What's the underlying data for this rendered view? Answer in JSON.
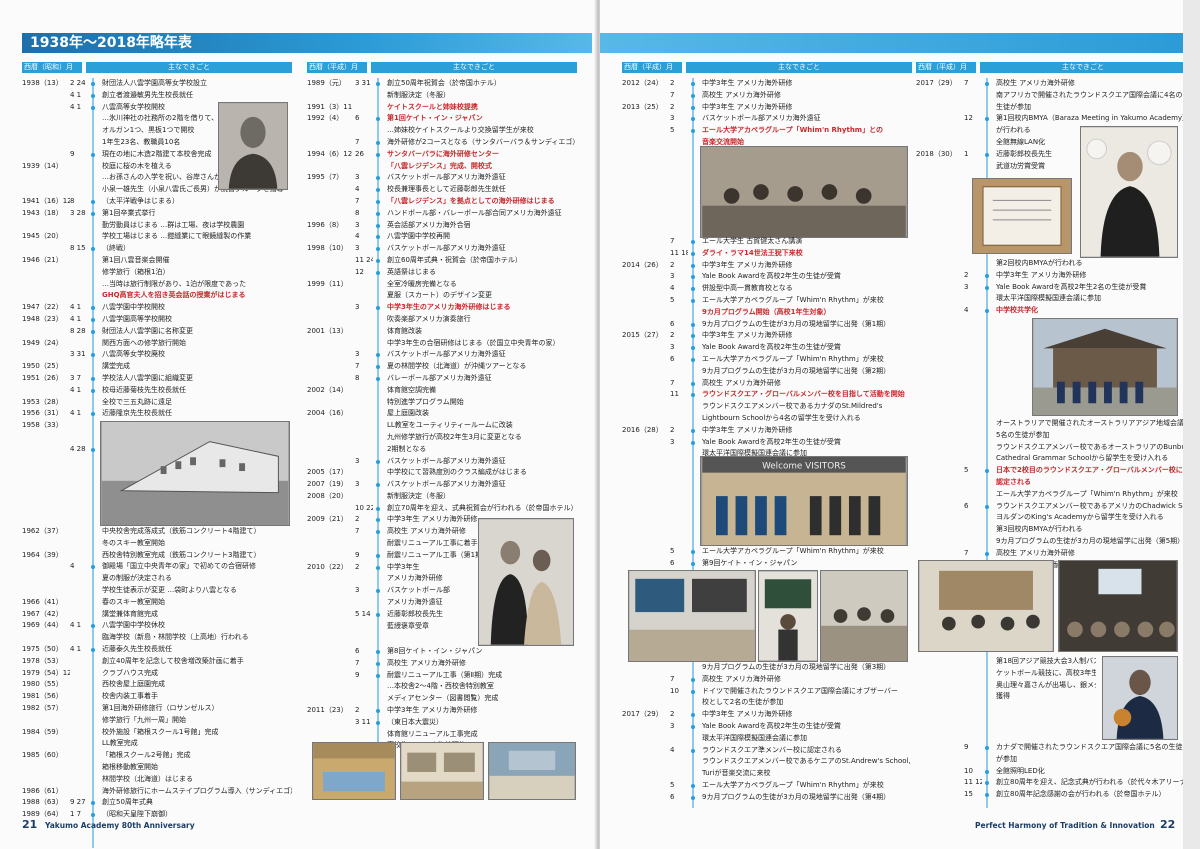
{
  "title": "1938年～2018年略年表",
  "headers": {
    "date": "西暦（昭和）月 日",
    "date2": "西暦（平成）月 日",
    "event": "主なできごと"
  },
  "columns": [
    {
      "id": "c1",
      "rows": [
        {
          "y": "1938（13）",
          "md": "2 24",
          "e": "財団法人八雲学園高等女学校設立"
        },
        {
          "y": "",
          "md": "4 1",
          "e": "創立者渡邉敏男先生校長就任"
        },
        {
          "y": "",
          "md": "4 1",
          "e": "八雲高等女学校開校"
        },
        {
          "y": "",
          "md": "",
          "e": "…氷川神社の社務所の2階を借りて、"
        },
        {
          "y": "",
          "md": "",
          "e": "オルガン1つ、黒板1つで開校"
        },
        {
          "y": "",
          "md": "",
          "e": "1年生23名、教職員10名"
        },
        {
          "y": "",
          "md": "9",
          "e": "現在の地に木造2階建て本校舎完成"
        },
        {
          "y": "1939（14）",
          "md": "",
          "e": "校庭に桜の木を植える"
        },
        {
          "y": "",
          "md": "",
          "e": "…お孫さんの入学を祝い、谷岸さんが若木をご寄贈"
        },
        {
          "y": "",
          "md": "",
          "e": "小泉一雄先生（小泉八雲氏ご長男）が読書グループを指導"
        },
        {
          "y": "1941（16）12",
          "md": "8",
          "e": "（太平洋戦争はじまる）"
        },
        {
          "y": "1943（18）",
          "md": "3 28",
          "e": "第1回卒業式挙行"
        },
        {
          "y": "",
          "md": "",
          "e": "勤労動員はじまる …群は工場、夜は学校農園"
        },
        {
          "y": "1945（20）",
          "md": "",
          "e": "学校工場はじまる …鎧縫業にて眼鏡縫製の作業"
        },
        {
          "y": "",
          "md": "8 15",
          "e": "（終戦）"
        },
        {
          "y": "1946（21）",
          "md": "",
          "e": "第1回八雲音楽会開催"
        },
        {
          "y": "",
          "md": "",
          "e": "修学旅行（箱根1泊）"
        },
        {
          "y": "",
          "md": "",
          "e": "…当時は旅行制限があり、1泊が限度であった"
        },
        {
          "y": "",
          "md": "",
          "e": "GHQ高官夫人を招き英会話の授業がはじまる",
          "hl": true
        },
        {
          "y": "1947（22）",
          "md": "4 1",
          "e": "八雲学園中学校開校"
        },
        {
          "y": "1948（23）",
          "md": "4 1",
          "e": "八雲学園高等学校開校"
        },
        {
          "y": "",
          "md": "8 28",
          "e": "財団法人八雲学園に名称変更"
        },
        {
          "y": "1949（24）",
          "md": "",
          "e": "関西方面への修学旅行開始"
        },
        {
          "y": "",
          "md": "3 31",
          "e": "八雲高等女学校廃校"
        },
        {
          "y": "1950（25）",
          "md": "",
          "e": "講堂完成"
        },
        {
          "y": "1951（26）",
          "md": "3 7",
          "e": "学校法人八雲学園に組織変更"
        },
        {
          "y": "",
          "md": "4 1",
          "e": "校母近藤菊枝先生校長就任"
        },
        {
          "y": "1953（28）",
          "md": "",
          "e": "全校で三五丸跡に遠足"
        },
        {
          "y": "1956（31）",
          "md": "4 1",
          "e": "近藤隆京先生校長就任"
        },
        {
          "y": "1958（33）",
          "md": "",
          "e": "創立20周年"
        },
        {
          "y": "",
          "md": "",
          "e": "…記念事業として施設近代化計画に着手"
        },
        {
          "y": "",
          "md": "4 28",
          "e": "東校舎完成落成式（鉄筋コンクリート3階建て）"
        }
      ]
    },
    {
      "id": "c1b",
      "rows": [
        {
          "y": "1962（37）",
          "md": "",
          "e": "中央校舎完成落成式（鉄筋コンクリート4階建て）"
        },
        {
          "y": "",
          "md": "",
          "e": "冬のスキー教室開始"
        },
        {
          "y": "1964（39）",
          "md": "",
          "e": "西校舎特別教室完成（鉄筋コンクリート3階建て）"
        },
        {
          "y": "",
          "md": "4",
          "e": "御殿場「国立中央青年の家」で初めての合宿研修"
        },
        {
          "y": "",
          "md": "",
          "e": "夏の制服が決定される"
        },
        {
          "y": "",
          "md": "",
          "e": "学校生徒表示が変更 …袋町より八雲となる"
        },
        {
          "y": "1966（41）",
          "md": "",
          "e": "春のスキー教室開始"
        },
        {
          "y": "1967（42）",
          "md": "",
          "e": "講堂兼体育館完成"
        },
        {
          "y": "1969（44）",
          "md": "4 1",
          "e": "八雲学園中学校休校"
        },
        {
          "y": "",
          "md": "",
          "e": "臨海学校（新島・林間学校（上高地）行われる"
        },
        {
          "y": "1975（50）",
          "md": "4 1",
          "e": "近藤泰久先生校長就任"
        },
        {
          "y": "1978（53）",
          "md": "",
          "e": "創立40周年を記念して校舎増改築計画に着手"
        },
        {
          "y": "1979（54）12",
          "md": "",
          "e": "クラブハウス完成"
        },
        {
          "y": "1980（55）",
          "md": "",
          "e": "西校舎屋上庭園完成"
        },
        {
          "y": "1981（56）",
          "md": "",
          "e": "校舎内装工事着手"
        },
        {
          "y": "1982（57）",
          "md": "",
          "e": "第1回海外研修旅行（ロサンゼルス）"
        },
        {
          "y": "",
          "md": "",
          "e": "修学旅行「九州一周」開始"
        },
        {
          "y": "1984（59）",
          "md": "",
          "e": "校外施設「箱根スクール1号館」完成"
        },
        {
          "y": "",
          "md": "",
          "e": "LL教室完成"
        },
        {
          "y": "1985（60）",
          "md": "",
          "e": "「箱根スクール2号館」完成"
        },
        {
          "y": "",
          "md": "",
          "e": "箱根移動教室開始"
        },
        {
          "y": "",
          "md": "",
          "e": "林間学校（北海道）はじまる"
        },
        {
          "y": "1986（61）",
          "md": "",
          "e": "海外研修旅行にホームステイプログラム導入（サンディエゴ）"
        },
        {
          "y": "1988（63）",
          "md": "9 27",
          "e": "創立50周年式典"
        },
        {
          "y": "1989（64）",
          "md": "1 7",
          "e": "（昭和天皇陛下崩御）"
        }
      ]
    },
    {
      "id": "c2",
      "rows": [
        {
          "y": "1989（元）",
          "md": "3 31",
          "e": "創立50周年祝賀会（於帝国ホテル）"
        },
        {
          "y": "",
          "md": "",
          "e": "新制服決定（冬服）"
        },
        {
          "y": "1991（3）11",
          "md": "",
          "e": "ケイトスクールと姉妹校提携",
          "hl": true
        },
        {
          "y": "1992（4）",
          "md": "6",
          "e": "第1回ケイト・イン・ジャパン",
          "hl": true
        },
        {
          "y": "",
          "md": "",
          "e": "…姉妹校ケイトスクールより交換留学生が来校"
        },
        {
          "y": "",
          "md": "7",
          "e": "海外研修が2コースとなる（サンタバーバラ＆サンディエゴ）"
        },
        {
          "y": "1994（6）12",
          "md": "26",
          "e": "サンタバーバラに海外研修センター",
          "hl": true
        },
        {
          "y": "",
          "md": "",
          "e": "「八雲レジデンス」完成、開校式",
          "hl": true
        },
        {
          "y": "1995（7）",
          "md": "3",
          "e": "バスケットボール部アメリカ海外遠征"
        },
        {
          "y": "",
          "md": "4",
          "e": "校長兼理事長として近藤彰郎先生就任"
        },
        {
          "y": "",
          "md": "7",
          "e": "「八雲レジデンス」を拠点としての海外研修はじまる",
          "hl": true
        },
        {
          "y": "",
          "md": "8",
          "e": "ハンドボール部・バレーボール部合同アメリカ海外遠征"
        },
        {
          "y": "1996（8）",
          "md": "3",
          "e": "英会話部アメリカ海外合宿"
        },
        {
          "y": "",
          "md": "4",
          "e": "八雲学園中学校再開"
        },
        {
          "y": "1998（10）",
          "md": "3",
          "e": "バスケットボール部アメリカ海外遠征"
        },
        {
          "y": "",
          "md": "11 24",
          "e": "創立60周年式典・祝賀会（於帝国ホテル）"
        },
        {
          "y": "",
          "md": "12",
          "e": "英語祭はじまる"
        },
        {
          "y": "1999（11）",
          "md": "",
          "e": "全室冷暖房完備となる"
        },
        {
          "y": "",
          "md": "",
          "e": "夏服（スカート）のデザイン変更"
        },
        {
          "y": "",
          "md": "3",
          "e": "中学3年生のアメリカ海外研修はじまる",
          "hl": true
        },
        {
          "y": "",
          "md": "",
          "e": "吹奏楽部アメリカ演奏旅行"
        },
        {
          "y": "2001（13）",
          "md": "",
          "e": "体育館改装"
        },
        {
          "y": "",
          "md": "",
          "e": "中学3年生の合宿研修はじまる（於国立中央青年の家）"
        },
        {
          "y": "",
          "md": "3",
          "e": "バスケットボール部アメリカ海外遠征"
        },
        {
          "y": "",
          "md": "7",
          "e": "夏の林間学校（北海道）が沖縄ツアーとなる"
        },
        {
          "y": "",
          "md": "8",
          "e": "バレーボール部アメリカ海外遠征"
        },
        {
          "y": "2002（14）",
          "md": "",
          "e": "体育館空調完備"
        },
        {
          "y": "",
          "md": "",
          "e": "特別進学プログラム開始"
        },
        {
          "y": "2004（16）",
          "md": "",
          "e": "屋上庭園改装"
        },
        {
          "y": "",
          "md": "",
          "e": "LL教室をユーティリティールームに改装"
        },
        {
          "y": "",
          "md": "",
          "e": "九州修学旅行が高校2年生3月に変更となる"
        },
        {
          "y": "",
          "md": "",
          "e": "2期制となる"
        },
        {
          "y": "",
          "md": "3",
          "e": "バスケットボール部アメリカ海外遠征"
        },
        {
          "y": "2005（17）",
          "md": "",
          "e": "中学校にて習熟度別のクラス編成がはじまる"
        },
        {
          "y": "2007（19）",
          "md": "3",
          "e": "バスケットボール部アメリカ海外遠征"
        },
        {
          "y": "2008（20）",
          "md": "",
          "e": "新制服決定（冬服）"
        },
        {
          "y": "",
          "md": "10 22",
          "e": "創立70周年を迎え、式典祝賀会が行われる（於帝国ホテル）"
        },
        {
          "y": "2009（21）",
          "md": "2",
          "e": "中学3年生 アメリカ海外研修"
        },
        {
          "y": "",
          "md": "7",
          "e": "高校生 アメリカ海外研修"
        },
        {
          "y": "",
          "md": "",
          "e": "耐震リニューアル工事に着手"
        },
        {
          "y": "",
          "md": "9",
          "e": "耐震リニューアル工事（第1期）完成…本校舎1階・東校舎"
        },
        {
          "y": "2010（22）",
          "md": "2",
          "e": "中学3年生"
        },
        {
          "y": "",
          "md": "",
          "e": "アメリカ海外研修"
        },
        {
          "y": "",
          "md": "3",
          "e": "バスケットボール部"
        },
        {
          "y": "",
          "md": "",
          "e": "アメリカ海外遠征"
        },
        {
          "y": "",
          "md": "5 14",
          "e": "近藤彰郎校長先生"
        },
        {
          "y": "",
          "md": "",
          "e": "藍綬褒章受章"
        }
      ]
    },
    {
      "id": "c2b",
      "rows": [
        {
          "y": "",
          "md": "6",
          "e": "第8回ケイト・イン・ジャパン"
        },
        {
          "y": "",
          "md": "7",
          "e": "高校生 アメリカ海外研修"
        },
        {
          "y": "",
          "md": "9",
          "e": "耐震リニューアル工事（第Ⅱ期）完成"
        },
        {
          "y": "",
          "md": "",
          "e": "…本校舎2～4階・西校舎特別教室"
        },
        {
          "y": "",
          "md": "",
          "e": "メディアセンター（図書閲覧）完成"
        },
        {
          "y": "2011（23）",
          "md": "2",
          "e": "中学3年生 アメリカ海外研修"
        },
        {
          "y": "",
          "md": "3 11",
          "e": "（東日本大震災）"
        },
        {
          "y": "",
          "md": "",
          "e": "体育館リニューアル工事完成"
        },
        {
          "y": "",
          "md": "7",
          "e": "高校生 アメリカ海外研修"
        }
      ]
    },
    {
      "id": "c3",
      "rows": [
        {
          "y": "2012（24）",
          "md": "2",
          "e": "中学3年生 アメリカ海外研修"
        },
        {
          "y": "",
          "md": "7",
          "e": "高校生 アメリカ海外研修"
        },
        {
          "y": "2013（25）",
          "md": "2",
          "e": "中学3年生 アメリカ海外研修"
        },
        {
          "y": "",
          "md": "3",
          "e": "バスケットボール部アメリカ海外遠征"
        },
        {
          "y": "",
          "md": "5",
          "e": "エール大学アカペラグループ「Whim'n Rhythm」との",
          "hl": true
        },
        {
          "y": "",
          "md": "",
          "e": "音楽交流開始",
          "hl": true
        }
      ]
    },
    {
      "id": "c3b",
      "rows": [
        {
          "y": "",
          "md": "7",
          "e": "エール大学生 古賀健太さん講演"
        },
        {
          "y": "",
          "md": "11 18",
          "e": "ダライ・ラマ14世法王猊下来校",
          "hl": true
        },
        {
          "y": "2014（26）",
          "md": "2",
          "e": "中学3年生 アメリカ海外研修"
        },
        {
          "y": "",
          "md": "3",
          "e": "Yale Book Awardを高校2年生の生徒が受賞"
        },
        {
          "y": "",
          "md": "4",
          "e": "併設型中高一貫教育校となる"
        },
        {
          "y": "",
          "md": "5",
          "e": "エール大学アカペラグループ「Whim'n Rhythm」が来校"
        },
        {
          "y": "",
          "md": "",
          "e": "9カ月プログラム開始（高校1年生対象）",
          "hl": true
        },
        {
          "y": "",
          "md": "6",
          "e": "9カ月プログラムの生徒が3カ月の現地留学に出発（第1期）"
        },
        {
          "y": "2015（27）",
          "md": "2",
          "e": "中学3年生 アメリカ海外研修"
        },
        {
          "y": "",
          "md": "3",
          "e": "Yale Book Awardを高校2年生の生徒が受賞"
        },
        {
          "y": "",
          "md": "6",
          "e": "エール大学アカペラグループ「Whim'n Rhythm」が来校"
        },
        {
          "y": "",
          "md": "",
          "e": "9カ月プログラムの生徒が3カ月の現地留学に出発（第2期）"
        },
        {
          "y": "",
          "md": "7",
          "e": "高校生 アメリカ海外研修"
        },
        {
          "y": "",
          "md": "11",
          "e": "ラウンドスクエア・グローバルメンバー校を目指して活動を開始",
          "hl": true
        },
        {
          "y": "",
          "md": "",
          "e": "ラウンドスクエアメンバー校であるカナダのSt.Mildred's"
        },
        {
          "y": "",
          "md": "",
          "e": "Lightbourn Schoolから4名の留学生を受け入れる"
        },
        {
          "y": "2016（28）",
          "md": "2",
          "e": "中学3年生 アメリカ海外研修"
        },
        {
          "y": "",
          "md": "3",
          "e": "Yale Book Awardを高校2年生の生徒が受賞"
        },
        {
          "y": "",
          "md": "",
          "e": "環太平洋国際模擬国連会議に参加"
        },
        {
          "y": "",
          "md": "",
          "e": "バスケットボール部アメリカ海外遠征"
        }
      ]
    },
    {
      "id": "c3c",
      "rows": [
        {
          "y": "",
          "md": "5",
          "e": "エール大学アカペラグループ「Whim'n Rhythm」が来校"
        },
        {
          "y": "",
          "md": "6",
          "e": "第9回ケイト・イン・ジャパン"
        }
      ]
    },
    {
      "id": "c3d",
      "rows": [
        {
          "y": "",
          "md": "",
          "e": "9カ月プログラムの生徒が3カ月の現地留学に出発（第3期）"
        },
        {
          "y": "",
          "md": "7",
          "e": "高校生 アメリカ海外研修"
        },
        {
          "y": "",
          "md": "10",
          "e": "ドイツで開催されたラウンドスクエア国際会議にオブザーバー"
        },
        {
          "y": "",
          "md": "",
          "e": "校として2名の生徒が参加"
        },
        {
          "y": "2017（29）",
          "md": "2",
          "e": "中学3年生 アメリカ海外研修"
        },
        {
          "y": "",
          "md": "3",
          "e": "Yale Book Awardを高校2年生の生徒が受賞"
        },
        {
          "y": "",
          "md": "",
          "e": "環太平洋国際模擬国連会議に参加"
        },
        {
          "y": "",
          "md": "4",
          "e": "ラウンドスクエア準メンバー校に認定される"
        },
        {
          "y": "",
          "md": "",
          "e": "ラウンドスクエアメンバー校であるケニアのSt.Andrew's School,"
        },
        {
          "y": "",
          "md": "",
          "e": "Turiが音楽交流に来校"
        },
        {
          "y": "",
          "md": "5",
          "e": "エール大学アカペラグループ「Whim'n Rhythm」が来校"
        },
        {
          "y": "",
          "md": "6",
          "e": "9カ月プログラムの生徒が3カ月の現地留学に出発（第4期）"
        }
      ]
    },
    {
      "id": "c4",
      "rows": [
        {
          "y": "2017（29）",
          "md": "7",
          "e": "高校生 アメリカ海外研修"
        },
        {
          "y": "",
          "md": "",
          "e": "南アフリカで開催されたラウンドスクエア国際会議に4名の"
        },
        {
          "y": "",
          "md": "",
          "e": "生徒が参加"
        },
        {
          "y": "",
          "md": "12",
          "e": "第1回校内BMYA（Baraza Meeting in Yakumo Academy）"
        },
        {
          "y": "",
          "md": "",
          "e": "が行われる"
        },
        {
          "y": "",
          "md": "",
          "e": "全館無線LAN化"
        },
        {
          "y": "2018（30）",
          "md": "1",
          "e": "近藤彰郎校長先生"
        },
        {
          "y": "",
          "md": "",
          "e": "武道功労賞受賞"
        }
      ]
    },
    {
      "id": "c4b",
      "rows": [
        {
          "y": "",
          "md": "",
          "e": "第2回校内BMYAが行われる"
        },
        {
          "y": "",
          "md": "2",
          "e": "中学3年生 アメリカ海外研修"
        },
        {
          "y": "",
          "md": "3",
          "e": "Yale Book Awardを高校2年生2名の生徒が受賞"
        },
        {
          "y": "",
          "md": "",
          "e": "環太平洋国際模擬国連会議に参加"
        },
        {
          "y": "",
          "md": "4",
          "e": "中学校共学化",
          "hl": true
        }
      ]
    },
    {
      "id": "c4c",
      "rows": [
        {
          "y": "",
          "md": "",
          "e": "オーストラリアで開催されたオーストラリアアジア地域会議に"
        },
        {
          "y": "",
          "md": "",
          "e": "5名の生徒が参加"
        },
        {
          "y": "",
          "md": "",
          "e": "ラウンドスクエアメンバー校であるオーストラリアのBunbury"
        },
        {
          "y": "",
          "md": "",
          "e": "Cathedral Grammar Schoolから留学生を受け入れる"
        },
        {
          "y": "",
          "md": "5",
          "e": "日本で2校目のラウンドスクエア・グローバルメンバー校に",
          "hl": true
        },
        {
          "y": "",
          "md": "",
          "e": "認定される",
          "hl": true
        },
        {
          "y": "",
          "md": "",
          "e": "エール大学アカペラグループ「Whim'n Rhythm」が来校"
        },
        {
          "y": "",
          "md": "6",
          "e": "ラウンドスクエアメンバー校であるアメリカのChadwick School、"
        },
        {
          "y": "",
          "md": "",
          "e": "ヨルダンのKing's Academyから留学生を受け入れる"
        },
        {
          "y": "",
          "md": "",
          "e": "第3回校内BMYAが行われる"
        },
        {
          "y": "",
          "md": "",
          "e": "9カ月プログラムの生徒が3カ月の現地留学に出発（第5期）"
        },
        {
          "y": "",
          "md": "7",
          "e": "高校生 アメリカ海外研修"
        },
        {
          "y": "",
          "md": "8",
          "e": "文化体験ツアー（香石）"
        }
      ]
    },
    {
      "id": "c4d",
      "rows": [
        {
          "y": "",
          "md": "",
          "e": "第18回アジア競技大会3人制バス"
        },
        {
          "y": "",
          "md": "",
          "e": "ケットボール競技に、高校3年生の"
        },
        {
          "y": "",
          "md": "",
          "e": "奥山理々嘉さんが出場し、銀メダルを"
        },
        {
          "y": "",
          "md": "",
          "e": "獲得"
        }
      ]
    },
    {
      "id": "c4e",
      "rows": [
        {
          "y": "",
          "md": "9",
          "e": "カナダで開催されたラウンドスクエア国際会議に5名の生徒"
        },
        {
          "y": "",
          "md": "",
          "e": "が参加"
        },
        {
          "y": "",
          "md": "10",
          "e": "全館照明LED化"
        },
        {
          "y": "",
          "md": "11 12",
          "e": "創立80周年を迎え、記念式典が行われる（於代々木アリーナ）"
        },
        {
          "y": "",
          "md": "15",
          "e": "創立80周年記念感謝の会が行われる（於帝国ホテル）"
        }
      ]
    }
  ],
  "photo_sign": "Welcome VISITORS",
  "footer": {
    "left_page": "21",
    "left_tag": "Yakumo Academy 80th Anniversary",
    "right_tag": "Perfect Harmony of Tradition & Innovation",
    "right_page": "22"
  }
}
